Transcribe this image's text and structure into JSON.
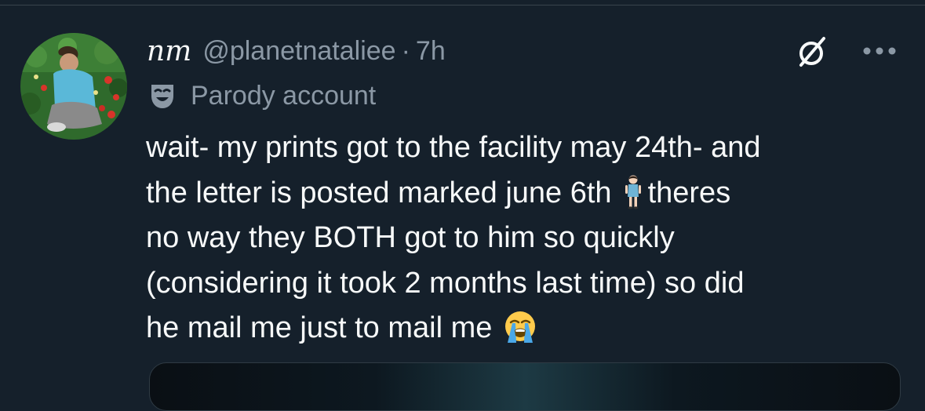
{
  "tweet": {
    "author": {
      "display_name": "nm",
      "handle": "@planetnataliee",
      "separator": "·",
      "time": "7h",
      "label": "Parody account",
      "label_icon": "theater-mask-icon",
      "avatar": "avatar-image"
    },
    "actions": {
      "grok_icon": "grok-icon",
      "more_icon": "more-icon"
    },
    "text_lines": [
      {
        "text": "wait- my prints got to the facility may 24th- and"
      },
      {
        "before": "the letter is posted marked june 6th",
        "emoji": "standing-woman-emoji",
        "after": "theres"
      },
      {
        "text": "no way they BOTH got to him so quickly"
      },
      {
        "text": "(considering it took 2 months last time) so did"
      },
      {
        "before": "he  mail me just to mail me",
        "emoji": "loudly-crying-face-emoji"
      }
    ]
  },
  "colors": {
    "background": "#15202b",
    "primary_text": "#f7f9f9",
    "secondary_text": "#8b98a5",
    "divider": "#38444d"
  }
}
